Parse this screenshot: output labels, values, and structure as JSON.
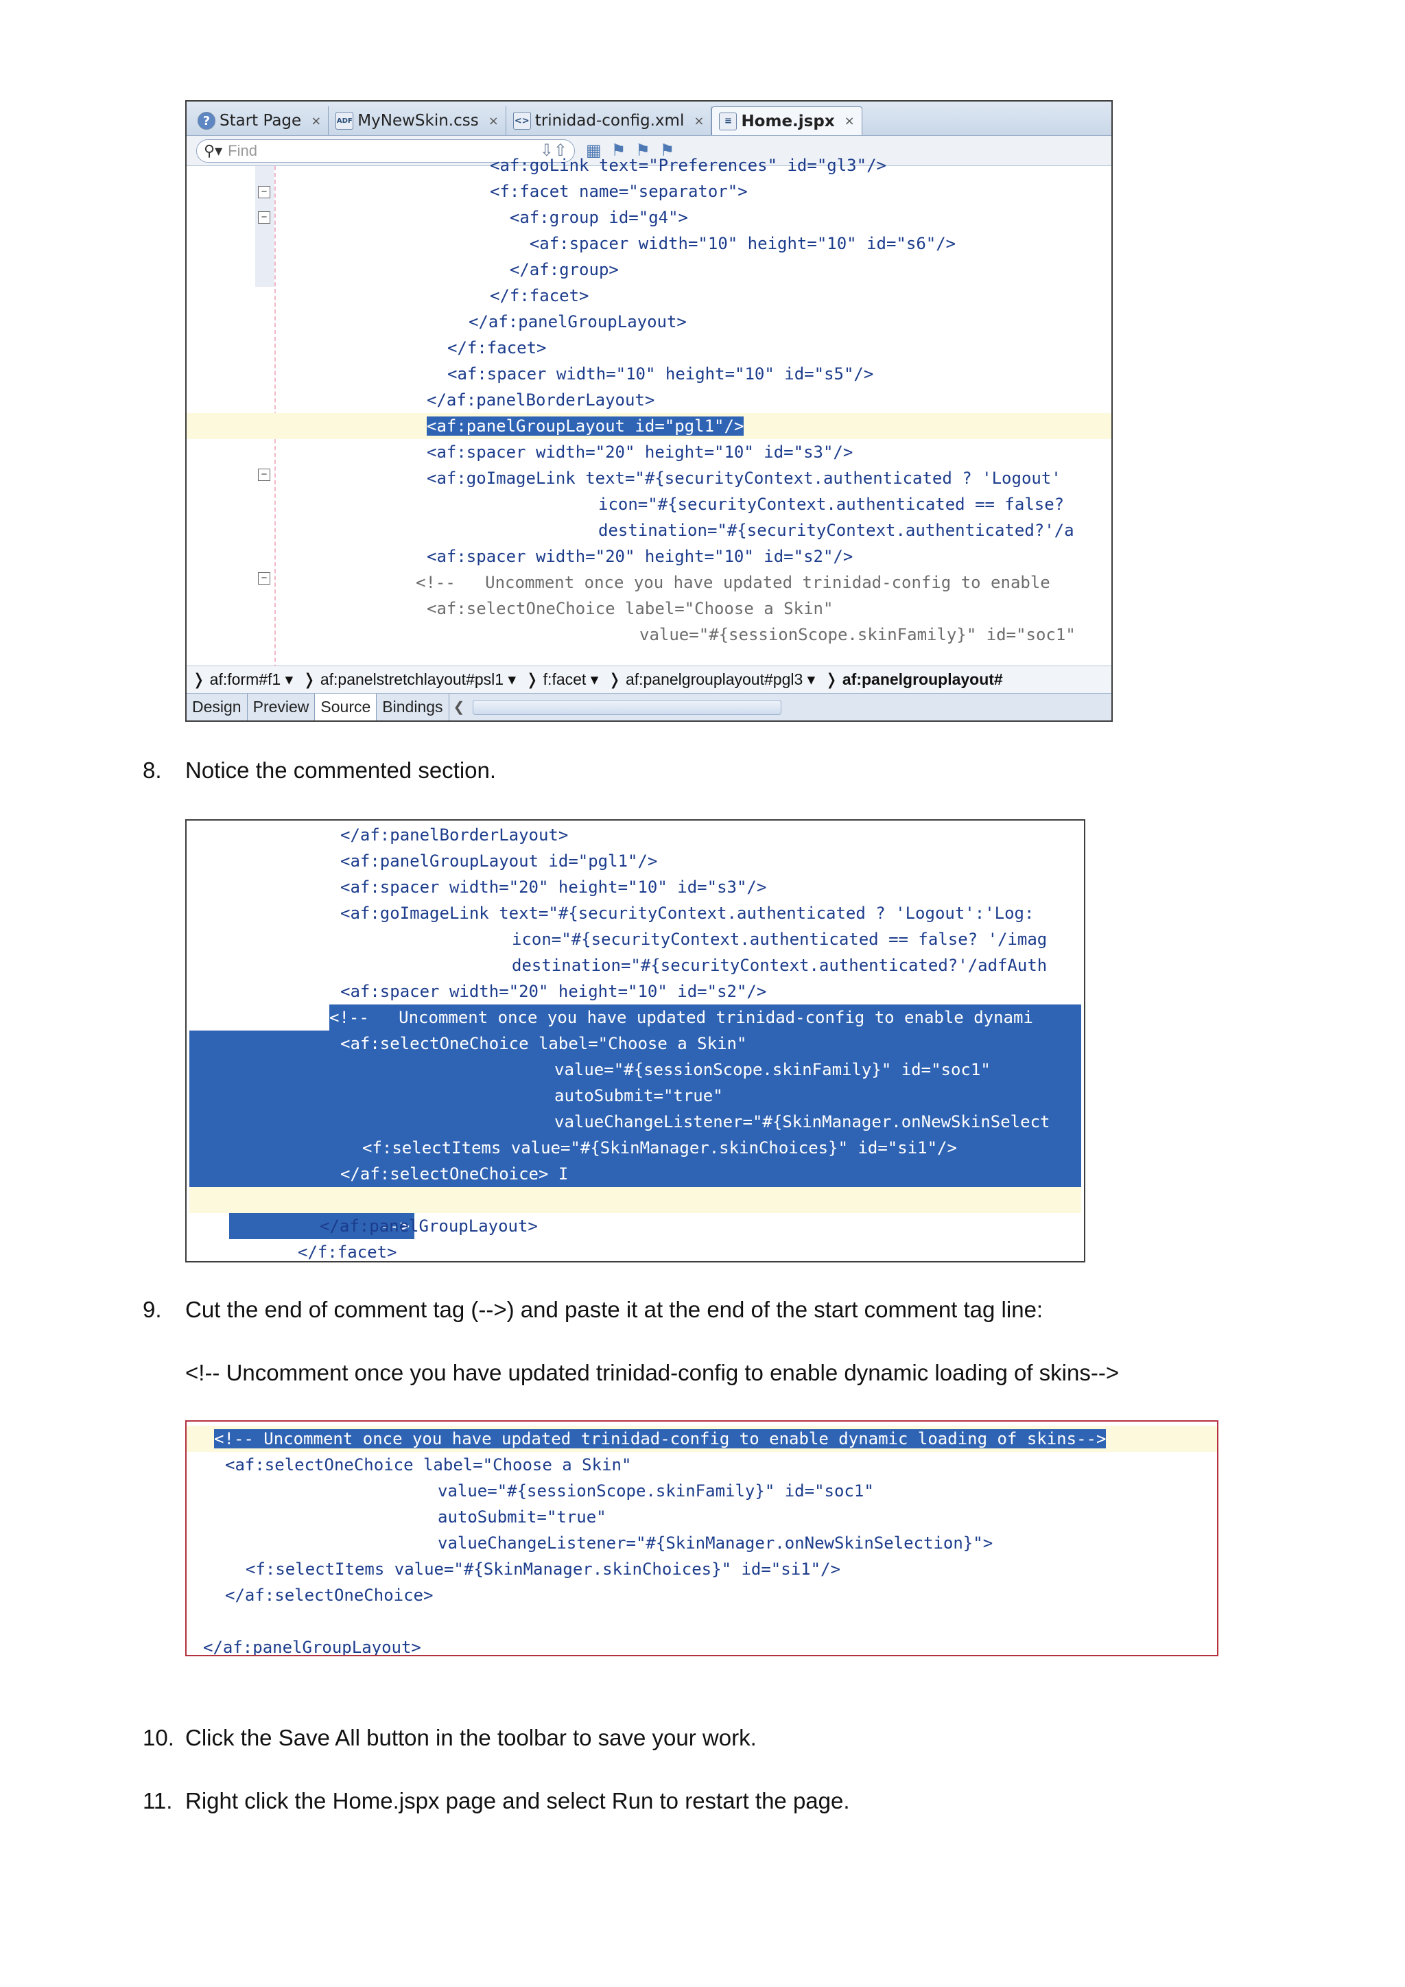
{
  "ide": {
    "tabs": [
      {
        "label": "Start Page",
        "icon": "help-icon",
        "icon_text": "?"
      },
      {
        "label": "MyNewSkin.css",
        "icon": "css-file-icon",
        "icon_text": "ADF"
      },
      {
        "label": "trinidad-config.xml",
        "icon": "xml-file-icon",
        "icon_text": "<>"
      },
      {
        "label": "Home.jspx",
        "icon": "jspx-file-icon",
        "icon_text": "≡"
      }
    ],
    "close_glyph": "×",
    "find_placeholder": "Find",
    "code_lines": [
      "<af:goLink text=\"Preferences\" id=\"gl3\"/>",
      "<f:facet name=\"separator\">",
      "  <af:group id=\"g4\">",
      "    <af:spacer width=\"10\" height=\"10\" id=\"s6\"/>",
      "  </af:group>",
      "</f:facet>",
      "</af:panelGroupLayout>",
      "</f:facet>",
      "<af:spacer width=\"10\" height=\"10\" id=\"s5\"/>",
      "</af:panelBorderLayout>",
      "<af:panelGroupLayout id=\"pgl1\"/>",
      "<af:spacer width=\"20\" height=\"10\" id=\"s3\"/>",
      "<af:goImageLink text=\"#{securityContext.authenticated ? 'Logout'",
      "icon=\"#{securityContext.authenticated == false?",
      "destination=\"#{securityContext.authenticated?'/a",
      "<af:spacer width=\"20\" height=\"10\" id=\"s2\"/>",
      "<!--   Uncomment once you have updated trinidad-config to enable",
      "<af:selectOneChoice label=\"Choose a Skin\"",
      "value=\"#{sessionScope.skinFamily}\" id=\"soc1\""
    ],
    "breadcrumbs": [
      "af:form#f1",
      "af:panelstretchlayout#psl1",
      "f:facet",
      "af:panelgrouplayout#pgl3",
      "af:panelgrouplayout#"
    ],
    "view_tabs": [
      "Design",
      "Preview",
      "Source",
      "Bindings"
    ]
  },
  "steps": {
    "s8": {
      "num": "8.",
      "text": "Notice the commented section."
    },
    "s9": {
      "num": "9.",
      "text": "Cut the end of comment tag (-->) and paste it at the end of the start comment tag line:"
    },
    "s9_line": "<!-- Uncomment once you have updated trinidad-config to enable dynamic loading of skins-->",
    "s10": {
      "num": "10.",
      "text": "Click the Save All button in the toolbar to save your work."
    },
    "s11": {
      "num": "11.",
      "text": "Right click the Home.jspx page and select Run to restart the page."
    }
  },
  "box2": {
    "lines": [
      "</af:panelBorderLayout>",
      "<af:panelGroupLayout id=\"pgl1\"/>",
      "<af:spacer width=\"20\" height=\"10\" id=\"s3\"/>",
      "<af:goImageLink text=\"#{securityContext.authenticated ? 'Logout':'Log:",
      "icon=\"#{securityContext.authenticated == false? '/imag",
      "destination=\"#{securityContext.authenticated?'/adfAuth",
      "<af:spacer width=\"20\" height=\"10\" id=\"s2\"/>",
      "<!--   Uncomment once you have updated trinidad-config to enable dynami",
      "<af:selectOneChoice label=\"Choose a Skin\"",
      "value=\"#{sessionScope.skinFamily}\" id=\"soc1\"",
      "autoSubmit=\"true\"",
      "valueChangeListener=\"#{SkinManager.onNewSkinSelect",
      "<f:selectItems value=\"#{SkinManager.skinChoices}\" id=\"si1\"/>",
      "</af:selectOneChoice>",
      "-->",
      "</af:panelGroupLayout>",
      "</f:facet>"
    ]
  },
  "box3": {
    "lines": [
      "<!-- Uncomment once you have updated trinidad-config to enable dynamic loading of skins-->",
      "<af:selectOneChoice label=\"Choose a Skin\"",
      "value=\"#{sessionScope.skinFamily}\" id=\"soc1\"",
      "autoSubmit=\"true\"",
      "valueChangeListener=\"#{SkinManager.onNewSkinSelection}\">",
      "<f:selectItems value=\"#{SkinManager.skinChoices}\" id=\"si1\"/>",
      "</af:selectOneChoice>",
      "",
      "</af:panelGroupLayout>"
    ]
  }
}
